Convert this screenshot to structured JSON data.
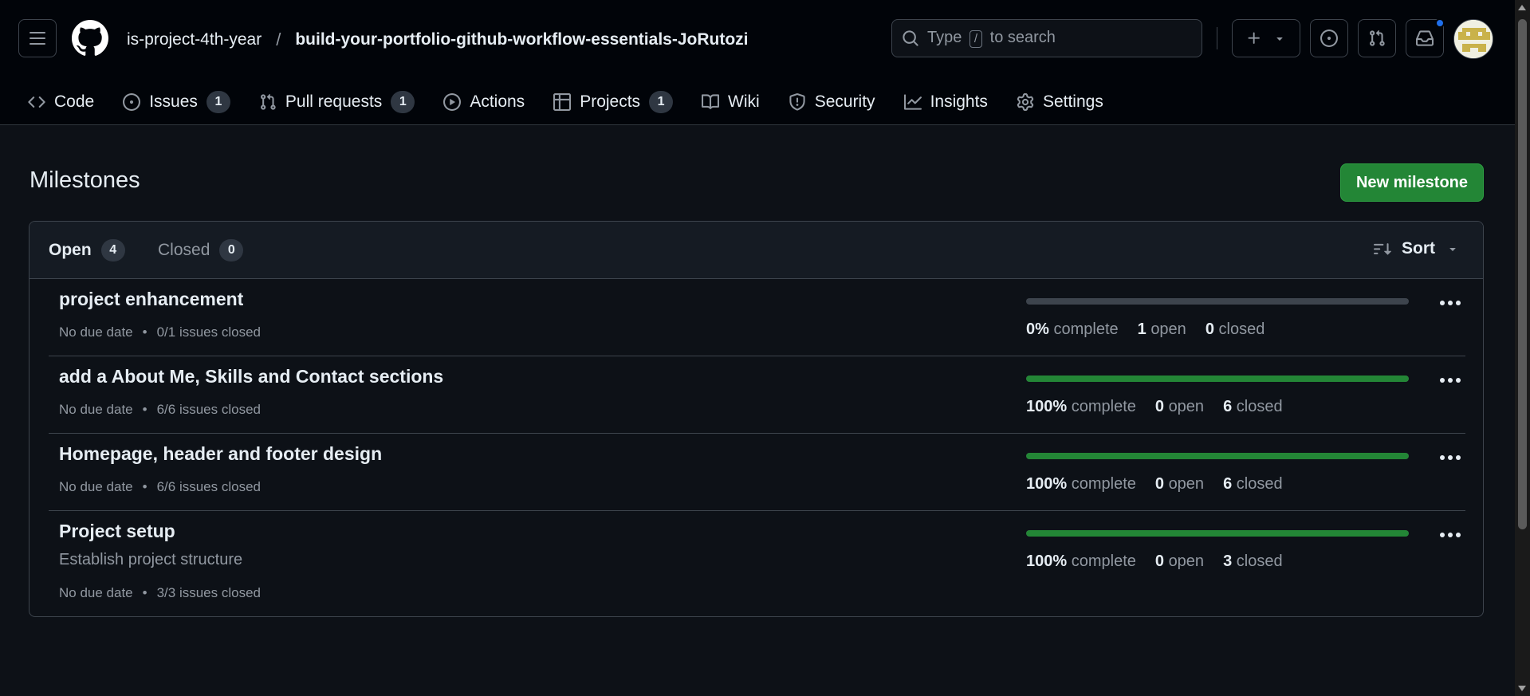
{
  "header": {
    "owner": "is-project-4th-year",
    "separator": "/",
    "repo": "build-your-portfolio-github-workflow-essentials-JoRutozi",
    "search": {
      "prefix": "Type",
      "key": "/",
      "suffix": "to search"
    }
  },
  "tabs": [
    {
      "label": "Code",
      "icon": "code-icon"
    },
    {
      "label": "Issues",
      "icon": "issue-opened-icon",
      "count": "1"
    },
    {
      "label": "Pull requests",
      "icon": "git-pull-request-icon",
      "count": "1"
    },
    {
      "label": "Actions",
      "icon": "play-icon"
    },
    {
      "label": "Projects",
      "icon": "table-icon",
      "count": "1"
    },
    {
      "label": "Wiki",
      "icon": "book-icon"
    },
    {
      "label": "Security",
      "icon": "shield-icon"
    },
    {
      "label": "Insights",
      "icon": "graph-icon"
    },
    {
      "label": "Settings",
      "icon": "gear-icon"
    }
  ],
  "page": {
    "title": "Milestones",
    "new_button": "New milestone"
  },
  "filters": {
    "open_label": "Open",
    "open_count": "4",
    "closed_label": "Closed",
    "closed_count": "0",
    "sort_label": "Sort"
  },
  "milestones": [
    {
      "title": "project enhancement",
      "description": "",
      "due": "No due date",
      "issues_closed": "0/1 issues closed",
      "progress_fraction": 0.0,
      "percent": "0%",
      "open": "1",
      "closed": "0"
    },
    {
      "title": "add a About Me, Skills and Contact sections",
      "description": "",
      "due": "No due date",
      "issues_closed": "6/6 issues closed",
      "progress_fraction": 1.0,
      "percent": "100%",
      "open": "0",
      "closed": "6"
    },
    {
      "title": "Homepage, header and footer design",
      "description": "",
      "due": "No due date",
      "issues_closed": "6/6 issues closed",
      "progress_fraction": 1.0,
      "percent": "100%",
      "open": "0",
      "closed": "6"
    },
    {
      "title": "Project setup",
      "description": "Establish project structure",
      "due": "No due date",
      "issues_closed": "3/3 issues closed",
      "progress_fraction": 1.0,
      "percent": "100%",
      "open": "0",
      "closed": "3"
    }
  ],
  "stat_labels": {
    "complete": "complete",
    "open": "open",
    "closed": "closed",
    "bullet": "•"
  },
  "colors": {
    "accent": "#238636",
    "background": "#0d1117",
    "header": "#010409",
    "notification": "#1f6feb"
  }
}
